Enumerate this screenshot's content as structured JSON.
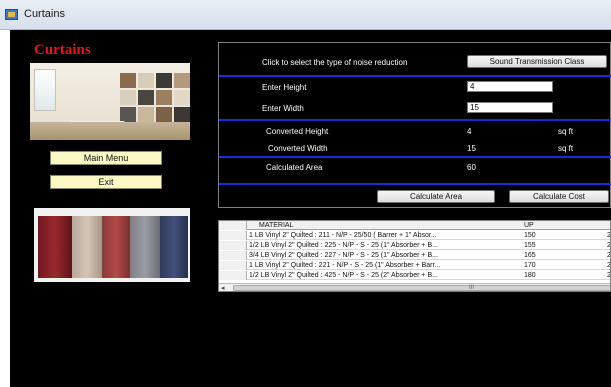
{
  "window": {
    "title": "Curtains",
    "icon": "app-form-icon"
  },
  "app": {
    "heading": "Curtains",
    "main_menu_label": "Main Menu",
    "exit_label": "Exit"
  },
  "form": {
    "noise_prompt": "Click to select the type of noise reduction",
    "noise_button": "Sound Transmission Class",
    "height_label": "Enter Height",
    "height_value": "4",
    "width_label": "Enter Width",
    "width_value": "15",
    "conv_height_label": "Converted  Height",
    "conv_height_value": "4",
    "conv_height_unit": "sq ft",
    "conv_width_label": "Converted  Width",
    "conv_width_value": "15",
    "conv_width_unit": "sq ft",
    "calc_area_label": "Calculated Area",
    "calc_area_value": "60",
    "calc_area_button": "Calculate Area",
    "calc_cost_button": "Calculate Cost"
  },
  "grid": {
    "columns": [
      "MATERIAL",
      "UP"
    ],
    "rows": [
      {
        "material": "1 LB Vinyl 2\" Quilted : 211 - N/P - 25/50 ( Barrer + 1\" Absor...",
        "up": "150",
        "extra": "2"
      },
      {
        "material": "1/2 LB Vinyl 2\" Quilted : 225 - N/P - S - 25 (1\" Absorber  + B...",
        "up": "155",
        "extra": "2"
      },
      {
        "material": "3/4 LB Vinyl 2\" Quilted : 227 - N/P - S - 25 (1\" Absorber  + B...",
        "up": "165",
        "extra": "2"
      },
      {
        "material": "1 LB Vinyl 2\" Quilted : 221 - N/P - S - 25 (1\" Absorber  + Barr...",
        "up": "170",
        "extra": "2"
      },
      {
        "material": "1/2 LB Vinyl 2\" Quilted : 425 - N/P - S - 25 (2\" Absorber  + B...",
        "up": "180",
        "extra": "2"
      }
    ],
    "scroll_left": "◂",
    "scroll_grip": "III"
  },
  "colors": {
    "background": "#000000",
    "heading": "#e4161b",
    "separator": "#1a2bd9",
    "button_yellow": "#fbf9c6"
  }
}
